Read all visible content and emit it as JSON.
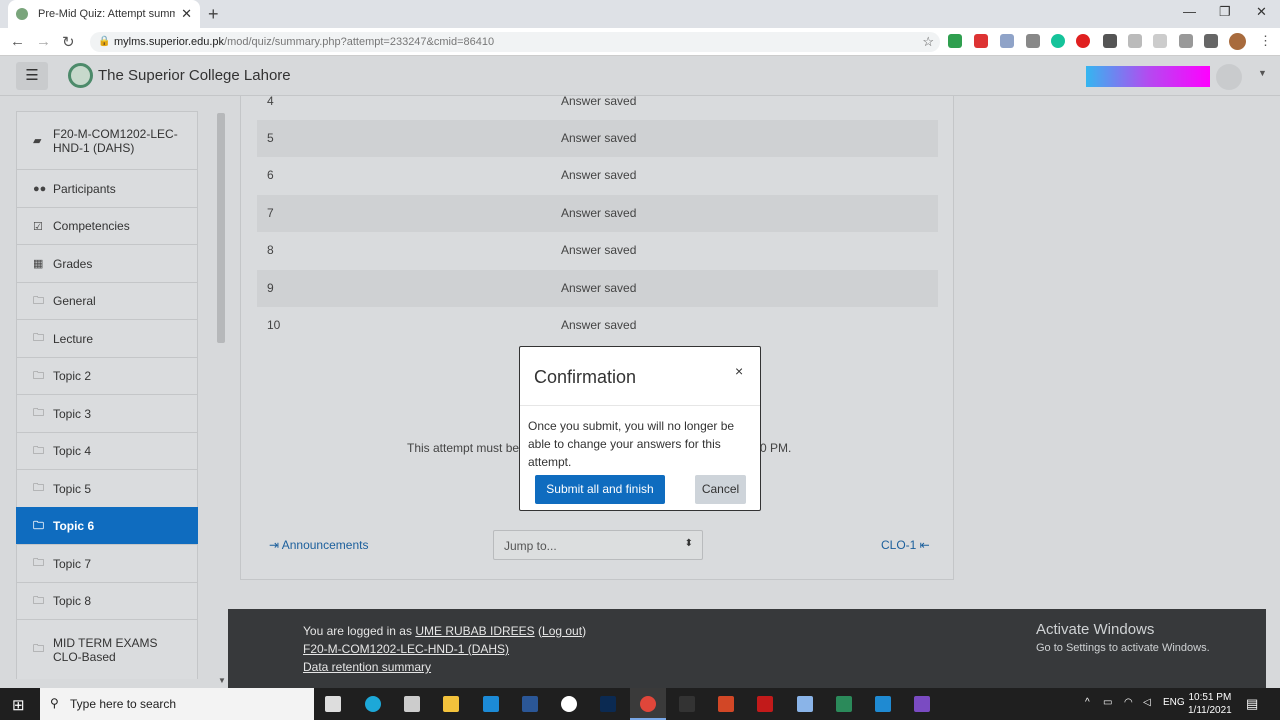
{
  "browser": {
    "tab_title": "Pre-Mid Quiz: Attempt summary",
    "tab_close": "✕",
    "new_tab": "+",
    "url_host": "mylms.superior.edu.pk",
    "url_path": "/mod/quiz/summary.php?attempt=233247&cmid=86410"
  },
  "site": {
    "name": "The Superior College Lahore"
  },
  "drawer": {
    "items": [
      {
        "label": "F20-M-COM1202-LEC-HND-1 (DAHS)",
        "icon": "book-icon"
      },
      {
        "label": "Participants",
        "icon": "users-icon"
      },
      {
        "label": "Competencies",
        "icon": "check-square-icon"
      },
      {
        "label": "Grades",
        "icon": "table-icon"
      },
      {
        "label": "General",
        "icon": "folder-icon"
      },
      {
        "label": "Lecture",
        "icon": "folder-icon"
      },
      {
        "label": "Topic 2",
        "icon": "folder-icon"
      },
      {
        "label": "Topic 3",
        "icon": "folder-icon"
      },
      {
        "label": "Topic 4",
        "icon": "folder-icon"
      },
      {
        "label": "Topic 5",
        "icon": "folder-icon"
      },
      {
        "label": "Topic 6",
        "icon": "folder-icon",
        "active": true
      },
      {
        "label": "Topic 7",
        "icon": "folder-icon"
      },
      {
        "label": "Topic 8",
        "icon": "folder-icon"
      },
      {
        "label": "MID TERM EXAMS CLO-Based",
        "icon": "folder-icon"
      }
    ]
  },
  "summary": {
    "rows": [
      {
        "question": "4",
        "status": "Answer saved"
      },
      {
        "question": "5",
        "status": "Answer saved"
      },
      {
        "question": "6",
        "status": "Answer saved"
      },
      {
        "question": "7",
        "status": "Answer saved"
      },
      {
        "question": "8",
        "status": "Answer saved"
      },
      {
        "question": "9",
        "status": "Answer saved"
      },
      {
        "question": "10",
        "status": "Answer saved"
      }
    ],
    "timing_left": "This attempt must be",
    "timing_right": "0 PM."
  },
  "nav": {
    "prev_label": "⇥ Announcements",
    "jump_label": "Jump to...",
    "next_label": "CLO-1 ⇤"
  },
  "footer": {
    "logged_in_prefix": "You are logged in as ",
    "user_name": "UME RUBAB IDREES",
    "logout": "Log out",
    "course": "F20-M-COM1202-LEC-HND-1 (DAHS)",
    "retention": "Data retention summary",
    "activate_title": "Activate Windows",
    "activate_sub": "Go to Settings to activate Windows."
  },
  "modal": {
    "title": "Confirmation",
    "close": "×",
    "body": "Once you submit, you will no longer be able to change your answers for this attempt.",
    "submit_label": "Submit all and finish",
    "cancel_label": "Cancel"
  },
  "taskbar": {
    "search_placeholder": "Type here to search",
    "lang": "ENG",
    "time": "10:51 PM",
    "date": "1/11/2021"
  }
}
